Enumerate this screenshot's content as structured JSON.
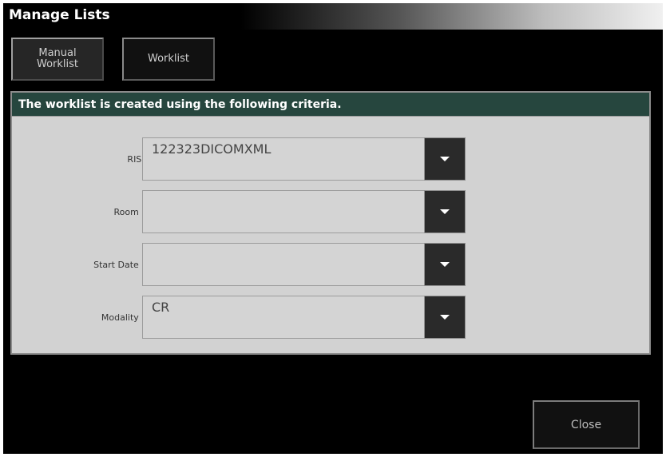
{
  "window": {
    "title": "Manage Lists"
  },
  "tabs": [
    {
      "label_line1": "Manual",
      "label_line2": "Worklist"
    },
    {
      "label": "Worklist"
    }
  ],
  "criteria": {
    "header": "The worklist is created using the following criteria.",
    "fields": [
      {
        "label": "RIS:",
        "value": "122323DICOMXML"
      },
      {
        "label": "Room :",
        "value": ""
      },
      {
        "label": "Start Date :",
        "value": ""
      },
      {
        "label": "Modality :",
        "value": "CR"
      }
    ]
  },
  "icons": {
    "dropdown": "chevron-down-icon"
  },
  "footer": {
    "close_label": "Close"
  }
}
